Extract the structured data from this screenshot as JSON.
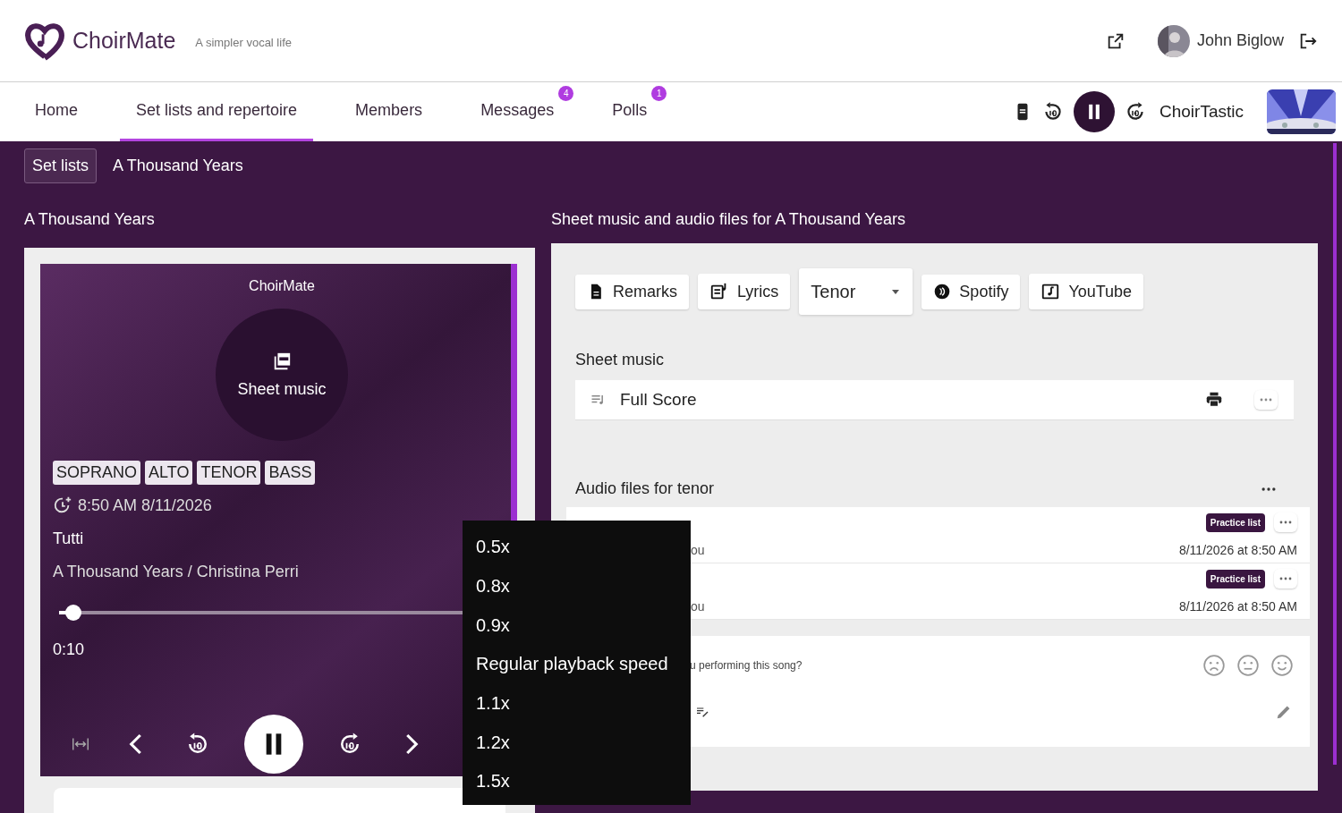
{
  "header": {
    "brand": "ChoirMate",
    "tagline": "A simpler vocal life",
    "user": "John Biglow"
  },
  "nav": {
    "tabs": [
      {
        "label": "Home",
        "selected": false
      },
      {
        "label": "Set lists and repertoire",
        "selected": true
      },
      {
        "label": "Members",
        "selected": false
      },
      {
        "label": "Messages",
        "selected": false,
        "badge": "4"
      },
      {
        "label": "Polls",
        "selected": false,
        "badge": "1"
      }
    ],
    "now_playing": {
      "choir": "ChoirTastic",
      "playing": true
    }
  },
  "breadcrumb": [
    {
      "label": "Set lists",
      "kind": "button"
    },
    {
      "label": "A Thousand Years",
      "kind": "text"
    }
  ],
  "song_title": "A Thousand Years",
  "files_title": "Sheet music and audio files for A Thousand Years",
  "player": {
    "source": "ChoirMate",
    "cover_label": "Sheet music",
    "voices": [
      "SOPRANO",
      "ALTO",
      "TENOR",
      "BASS"
    ],
    "timestamp": "8:50 AM 8/11/2026",
    "track": "Tutti",
    "subtitle": "A Thousand Years / Christina Perri",
    "level": 0.035,
    "elapsed": "0:10",
    "playing": true
  },
  "speed_menu": {
    "items": [
      "0.5x",
      "0.8x",
      "0.9x",
      "Regular playback speed",
      "1.1x",
      "1.2x",
      "1.5x"
    ]
  },
  "resources": [
    {
      "label": "Remarks",
      "kind": "remarks"
    },
    {
      "label": "Lyrics",
      "kind": "lyrics"
    },
    {
      "label": "Tenor",
      "kind": "select"
    },
    {
      "label": "Spotify",
      "kind": "spotify"
    },
    {
      "label": "YouTube",
      "kind": "youtube"
    }
  ],
  "sheet_music": {
    "title": "Sheet music",
    "items": [
      {
        "name": "Full Score"
      }
    ]
  },
  "audio": {
    "title": "Audio files for tenor",
    "files": [
      {
        "shared": "ou",
        "tag": "Practice list",
        "date": "8/11/2026 at 8:50 AM"
      },
      {
        "shared": "ou",
        "tag": "Practice list",
        "date": "8/11/2026 at 8:50 AM"
      }
    ]
  },
  "confidence": {
    "question": "u performing this song?"
  }
}
